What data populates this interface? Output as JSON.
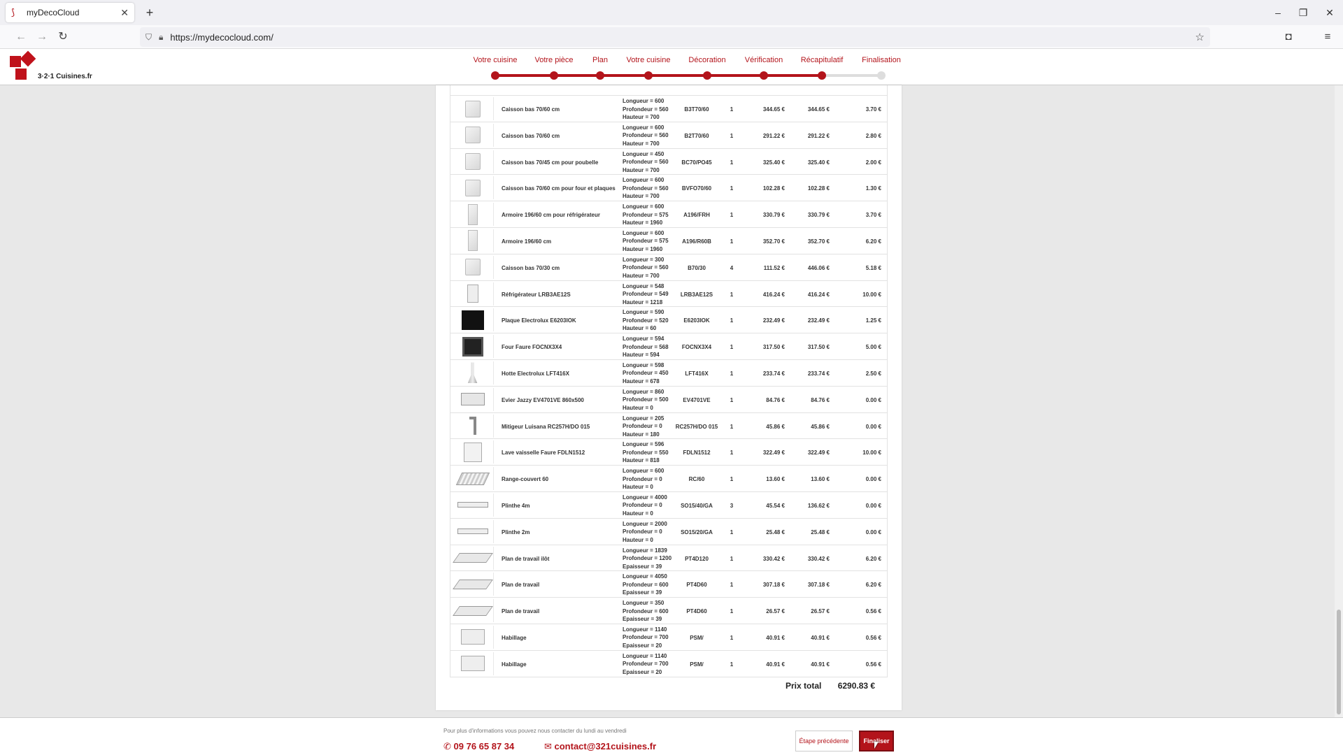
{
  "browser": {
    "tab_title": "myDecoCloud",
    "url": "https://mydecocloud.com/"
  },
  "header": {
    "logo_text": "3·2·1 Cuisines.fr",
    "steps": [
      {
        "label": "Votre cuisine",
        "done": true
      },
      {
        "label": "Votre pièce",
        "done": true
      },
      {
        "label": "Plan",
        "done": true
      },
      {
        "label": "Votre cuisine",
        "done": true
      },
      {
        "label": "Décoration",
        "done": true
      },
      {
        "label": "Vérification",
        "done": true
      },
      {
        "label": "Récapitulatif",
        "done": true
      },
      {
        "label": "Finalisation",
        "done": false
      }
    ]
  },
  "items": [
    {
      "icon": "cabinet-icon",
      "name": "Caisson bas 70/60 cm",
      "dims": [
        "Longueur = 600",
        "Profondeur = 560",
        "Hauteur = 700"
      ],
      "ref": "B3T70/60",
      "qty": "1",
      "unit": "344.65 €",
      "total": "344.65 €",
      "eco": "3.70 €"
    },
    {
      "icon": "cabinet-icon",
      "name": "Caisson bas 70/60 cm",
      "dims": [
        "Longueur = 600",
        "Profondeur = 560",
        "Hauteur = 700"
      ],
      "ref": "B2T70/60",
      "qty": "1",
      "unit": "291.22 €",
      "total": "291.22 €",
      "eco": "2.80 €"
    },
    {
      "icon": "cabinet-icon",
      "name": "Caisson bas 70/45 cm pour poubelle",
      "dims": [
        "Longueur = 450",
        "Profondeur = 560",
        "Hauteur = 700"
      ],
      "ref": "BC70/PO45",
      "qty": "1",
      "unit": "325.40 €",
      "total": "325.40 €",
      "eco": "2.00 €"
    },
    {
      "icon": "cabinet-icon",
      "name": "Caisson bas 70/60 cm pour four et plaques",
      "dims": [
        "Longueur = 600",
        "Profondeur = 560",
        "Hauteur = 700"
      ],
      "ref": "BVFO70/60",
      "qty": "1",
      "unit": "102.28 €",
      "total": "102.28 €",
      "eco": "1.30 €"
    },
    {
      "icon": "tall-cabinet-icon",
      "name": "Armoire 196/60 cm pour réfrigérateur",
      "dims": [
        "Longueur = 600",
        "Profondeur = 575",
        "Hauteur = 1960"
      ],
      "ref": "A196/FRH",
      "qty": "1",
      "unit": "330.79 €",
      "total": "330.79 €",
      "eco": "3.70 €"
    },
    {
      "icon": "tall-cabinet-icon",
      "name": "Armoire 196/60 cm",
      "dims": [
        "Longueur = 600",
        "Profondeur = 575",
        "Hauteur = 1960"
      ],
      "ref": "A196/R60B",
      "qty": "1",
      "unit": "352.70 €",
      "total": "352.70 €",
      "eco": "6.20 €"
    },
    {
      "icon": "cabinet-icon",
      "name": "Caisson bas 70/30 cm",
      "dims": [
        "Longueur = 300",
        "Profondeur = 560",
        "Hauteur = 700"
      ],
      "ref": "B70/30",
      "qty": "4",
      "unit": "111.52 €",
      "total": "446.06 €",
      "eco": "5.18 €"
    },
    {
      "icon": "fridge-icon",
      "name": "Réfrigérateur LRB3AE12S",
      "dims": [
        "Longueur = 548",
        "Profondeur = 549",
        "Hauteur = 1218"
      ],
      "ref": "LRB3AE12S",
      "qty": "1",
      "unit": "416.24 €",
      "total": "416.24 €",
      "eco": "10.00 €"
    },
    {
      "icon": "hob-icon",
      "name": "Plaque Electrolux E6203IOK",
      "dims": [
        "Longueur = 590",
        "Profondeur = 520",
        "Hauteur = 60"
      ],
      "ref": "E6203IOK",
      "qty": "1",
      "unit": "232.49 €",
      "total": "232.49 €",
      "eco": "1.25 €"
    },
    {
      "icon": "oven-icon",
      "name": "Four Faure FOCNX3X4",
      "dims": [
        "Longueur = 594",
        "Profondeur = 568",
        "Hauteur = 594"
      ],
      "ref": "FOCNX3X4",
      "qty": "1",
      "unit": "317.50 €",
      "total": "317.50 €",
      "eco": "5.00 €"
    },
    {
      "icon": "hood-icon",
      "name": "Hotte Electrolux LFT416X",
      "dims": [
        "Longueur = 598",
        "Profondeur = 450",
        "Hauteur = 678"
      ],
      "ref": "LFT416X",
      "qty": "1",
      "unit": "233.74 €",
      "total": "233.74 €",
      "eco": "2.50 €"
    },
    {
      "icon": "sink-icon",
      "name": "Evier Jazzy EV4701VE 860x500",
      "dims": [
        "Longueur = 860",
        "Profondeur = 500",
        "Hauteur = 0"
      ],
      "ref": "EV4701VE",
      "qty": "1",
      "unit": "84.76 €",
      "total": "84.76 €",
      "eco": "0.00 €"
    },
    {
      "icon": "mixer-tap-icon",
      "name": "Mitigeur Luisana RC257H/DO 015",
      "dims": [
        "Longueur = 205",
        "Profondeur = 0",
        "Hauteur = 180"
      ],
      "ref": "RC257H/DO 015",
      "qty": "1",
      "unit": "45.86 €",
      "total": "45.86 €",
      "eco": "0.00 €"
    },
    {
      "icon": "dishwasher-icon",
      "name": "Lave vaisselle Faure FDLN1512",
      "dims": [
        "Longueur = 596",
        "Profondeur = 550",
        "Hauteur = 818"
      ],
      "ref": "FDLN1512",
      "qty": "1",
      "unit": "322.49 €",
      "total": "322.49 €",
      "eco": "10.00 €"
    },
    {
      "icon": "cutlery-tray-icon",
      "name": "Range-couvert 60",
      "dims": [
        "Longueur = 600",
        "Profondeur = 0",
        "Hauteur = 0"
      ],
      "ref": "RC/60",
      "qty": "1",
      "unit": "13.60 €",
      "total": "13.60 €",
      "eco": "0.00 €"
    },
    {
      "icon": "plinth-icon",
      "name": "Plinthe 4m",
      "dims": [
        "Longueur = 4000",
        "Profondeur = 0",
        "Hauteur = 0"
      ],
      "ref": "SO15/40/GA",
      "qty": "3",
      "unit": "45.54 €",
      "total": "136.62 €",
      "eco": "0.00 €"
    },
    {
      "icon": "plinth-icon",
      "name": "Plinthe 2m",
      "dims": [
        "Longueur = 2000",
        "Profondeur = 0",
        "Hauteur = 0"
      ],
      "ref": "SO15/20/GA",
      "qty": "1",
      "unit": "25.48 €",
      "total": "25.48 €",
      "eco": "0.00 €"
    },
    {
      "icon": "worktop-icon",
      "name": "Plan de travail ilôt",
      "dims": [
        "Longueur = 1839",
        "Profondeur = 1200",
        "Epaisseur = 39"
      ],
      "ref": "PT4D120",
      "qty": "1",
      "unit": "330.42 €",
      "total": "330.42 €",
      "eco": "6.20 €"
    },
    {
      "icon": "worktop-icon",
      "name": "Plan de travail",
      "dims": [
        "Longueur = 4050",
        "Profondeur = 600",
        "Epaisseur = 39"
      ],
      "ref": "PT4D60",
      "qty": "1",
      "unit": "307.18 €",
      "total": "307.18 €",
      "eco": "6.20 €"
    },
    {
      "icon": "worktop-icon",
      "name": "Plan de travail",
      "dims": [
        "Longueur = 350",
        "Profondeur = 600",
        "Epaisseur = 39"
      ],
      "ref": "PT4D60",
      "qty": "1",
      "unit": "26.57 €",
      "total": "26.57 €",
      "eco": "0.56 €"
    },
    {
      "icon": "panel-icon",
      "name": "Habillage",
      "dims": [
        "Longueur = 1140",
        "Profondeur = 700",
        "Epaisseur = 20"
      ],
      "ref": "PSM/",
      "qty": "1",
      "unit": "40.91 €",
      "total": "40.91 €",
      "eco": "0.56 €"
    },
    {
      "icon": "panel-icon",
      "name": "Habillage",
      "dims": [
        "Longueur = 1140",
        "Profondeur = 700",
        "Epaisseur = 20"
      ],
      "ref": "PSM/",
      "qty": "1",
      "unit": "40.91 €",
      "total": "40.91 €",
      "eco": "0.56 €"
    }
  ],
  "summary": {
    "total_label": "Prix total",
    "total_value": "6290.83 €"
  },
  "footer": {
    "info": "Pour plus d'informations vous pouvez nous contacter du lundi au vendredi",
    "phone": "09 76 65 87 34",
    "email": "contact@321cuisines.fr",
    "prev_label": "Étape précédente",
    "next_label": "Finaliser"
  },
  "colors": {
    "brand": "#b3141b",
    "inactive_step": "#dddddd"
  }
}
